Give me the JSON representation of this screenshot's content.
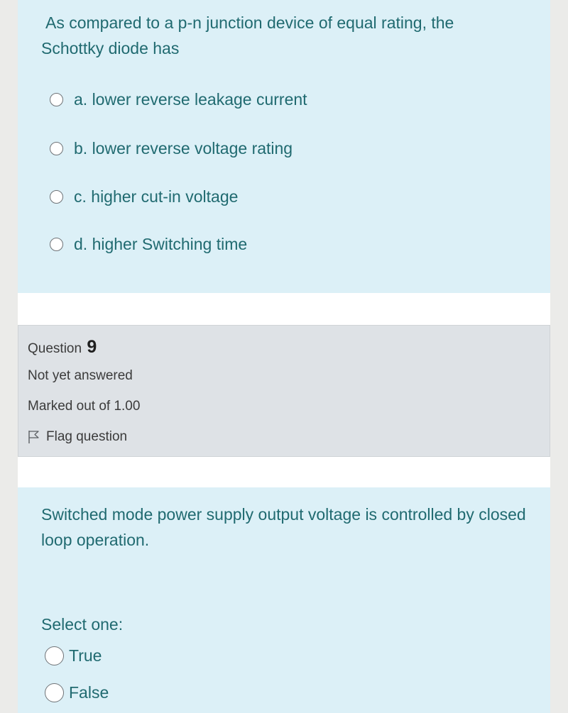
{
  "question8": {
    "text_line1": "As compared to a p-n junction device of equal rating, the",
    "text_line2": "Schottky diode has",
    "options": [
      {
        "label": "a. lower reverse leakage current"
      },
      {
        "label": "b. lower reverse voltage rating"
      },
      {
        "label": "c.  higher cut-in voltage"
      },
      {
        "label": "d.  higher Switching time"
      }
    ]
  },
  "question9_info": {
    "question_label": "Question",
    "question_number": "9",
    "status": "Not yet answered",
    "marks": "Marked out of 1.00",
    "flag_label": "Flag question"
  },
  "question9": {
    "text": "Switched mode power supply output voltage is controlled by closed loop operation.",
    "select_prompt": "Select one:",
    "options": [
      {
        "label": "True"
      },
      {
        "label": "False"
      }
    ]
  },
  "colors": {
    "question_bg": "#dcf0f7",
    "question_text": "#206a70",
    "info_bg": "#dee2e6"
  }
}
